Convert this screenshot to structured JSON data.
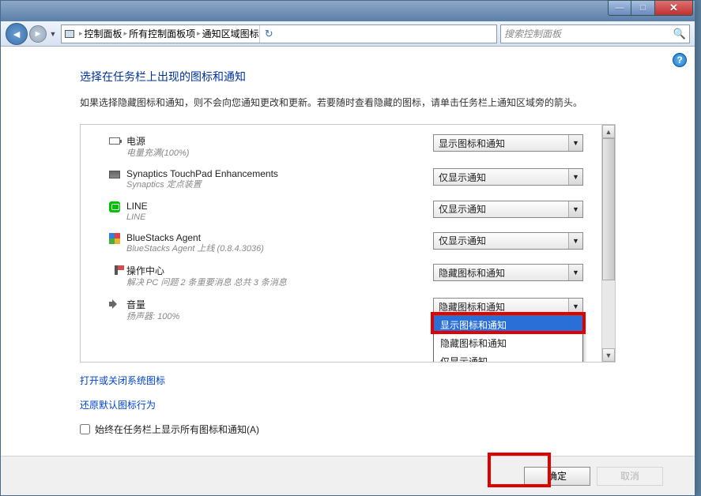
{
  "breadcrumb": {
    "root_icon": "computer-icon",
    "items": [
      "控制面板",
      "所有控制面板项",
      "通知区域图标"
    ]
  },
  "search": {
    "placeholder": "搜索控制面板"
  },
  "page": {
    "title": "选择在任务栏上出现的图标和通知",
    "desc": "如果选择隐藏图标和通知，则不会向您通知更改和更新。若要随时查看隐藏的图标，请单击任务栏上通知区域旁的箭头。"
  },
  "options": {
    "show_icon_and_notify": "显示图标和通知",
    "hide_icon_and_notify": "隐藏图标和通知",
    "only_notify": "仅显示通知"
  },
  "items": [
    {
      "icon": "battery-icon",
      "name": "电源",
      "sub": "电量充满(100%)",
      "value": "显示图标和通知"
    },
    {
      "icon": "touchpad-icon",
      "name": "Synaptics TouchPad Enhancements",
      "sub": "Synaptics 定点装置",
      "value": "仅显示通知"
    },
    {
      "icon": "line-icon",
      "name": "LINE",
      "sub": "LINE",
      "value": "仅显示通知"
    },
    {
      "icon": "bluestacks-icon",
      "name": "BlueStacks Agent",
      "sub": "BlueStacks Agent 上线 (0.8.4.3036)",
      "value": "仅显示通知"
    },
    {
      "icon": "flag-icon",
      "name": "操作中心",
      "sub": "解决 PC 问题   2 条重要消息  总共 3 条消息",
      "value": "隐藏图标和通知"
    },
    {
      "icon": "volume-icon",
      "name": "音量",
      "sub": "扬声器: 100%",
      "value": "隐藏图标和通知",
      "open": true
    }
  ],
  "links": {
    "system_icons": "打开或关闭系统图标",
    "restore_defaults": "还原默认图标行为"
  },
  "checkbox": {
    "label": "始终在任务栏上显示所有图标和通知(A)",
    "checked": false
  },
  "footer": {
    "ok": "确定",
    "cancel": "取消"
  }
}
